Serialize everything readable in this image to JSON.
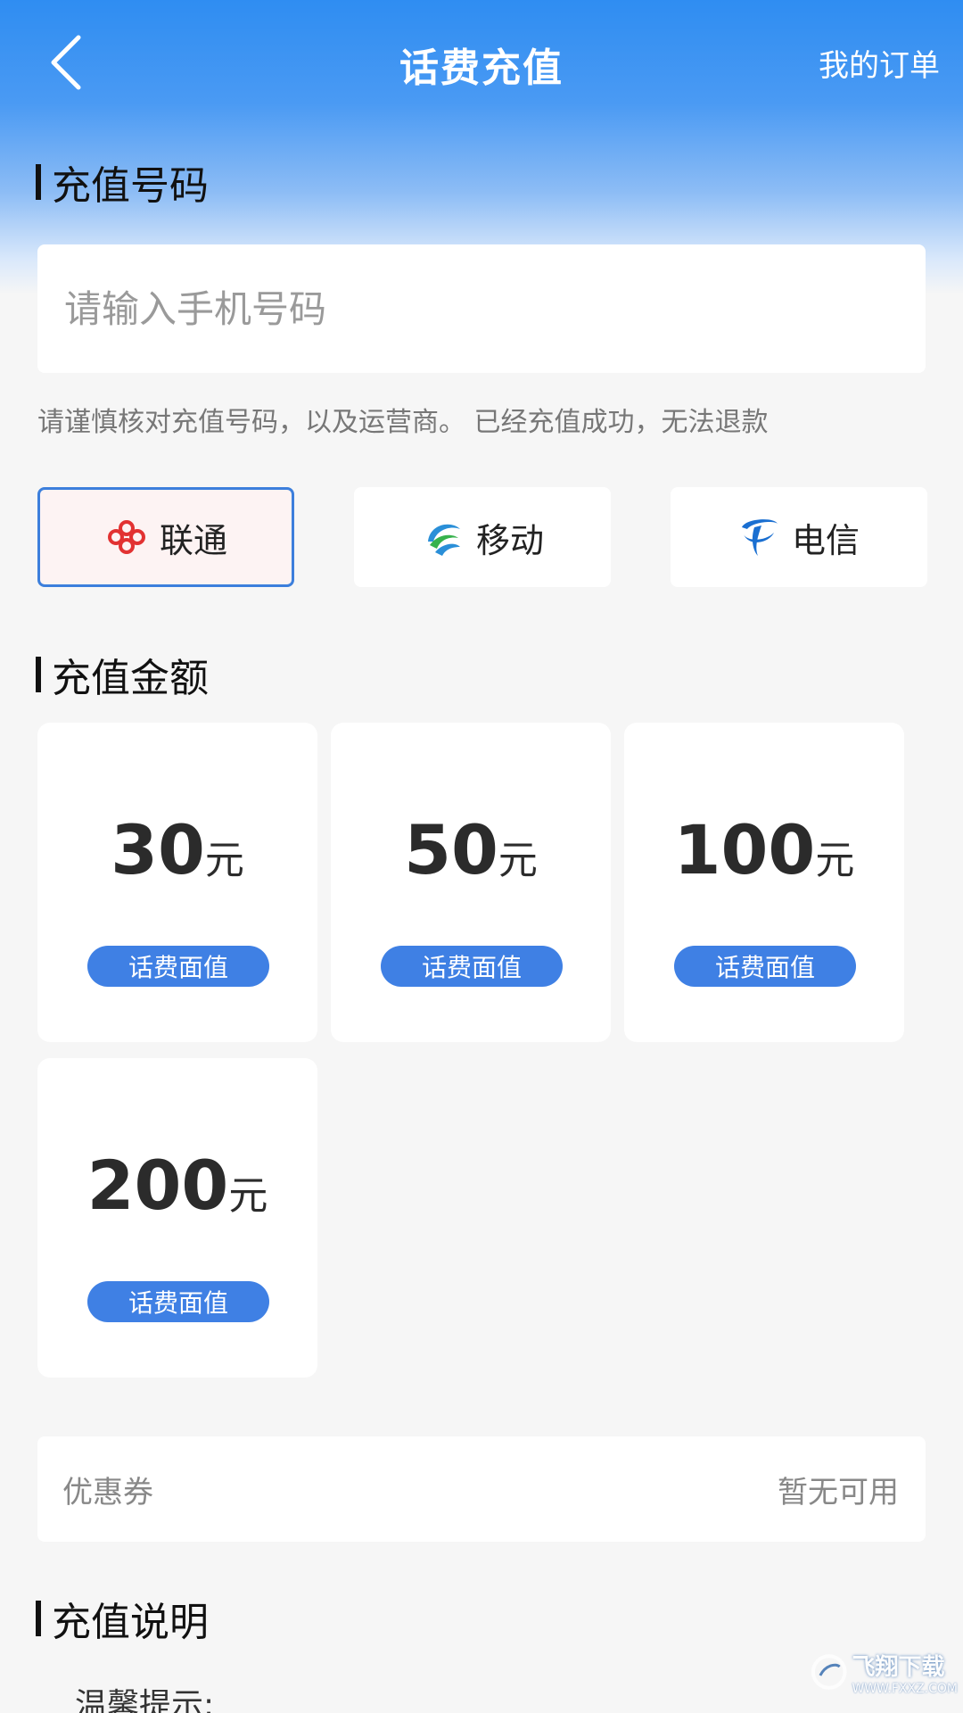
{
  "nav": {
    "title": "话费充值",
    "right_link": "我的订单"
  },
  "sections": {
    "phone_title": "充值号码",
    "amount_title": "充值金额",
    "instructions_title": "充值说明"
  },
  "phone": {
    "placeholder": "请输入手机号码",
    "value": "",
    "notice": "请谨慎核对充值号码，以及运营商。 已经充值成功，无法退款"
  },
  "carriers": [
    {
      "label": "联通",
      "icon": "china-unicom-logo-icon",
      "selected": true
    },
    {
      "label": "移动",
      "icon": "china-mobile-logo-icon",
      "selected": false
    },
    {
      "label": "电信",
      "icon": "china-telecom-logo-icon",
      "selected": false
    }
  ],
  "amounts": [
    {
      "value": "30",
      "unit": "元",
      "tag": "话费面值"
    },
    {
      "value": "50",
      "unit": "元",
      "tag": "话费面值"
    },
    {
      "value": "100",
      "unit": "元",
      "tag": "话费面值"
    },
    {
      "value": "200",
      "unit": "元",
      "tag": "话费面值"
    }
  ],
  "coupon": {
    "label": "优惠券",
    "status": "暂无可用"
  },
  "instructions": {
    "tip": "温馨提示:"
  },
  "watermark": {
    "main": "飞翔下载",
    "sub": "WWW.FXXZ.COM"
  },
  "colors": {
    "header_blue": "#2f8df2",
    "accent_blue": "#3f80e4",
    "selected_border": "#3c7fdc",
    "unicom_red": "#e23232",
    "telecom_blue": "#1a6fd1"
  }
}
